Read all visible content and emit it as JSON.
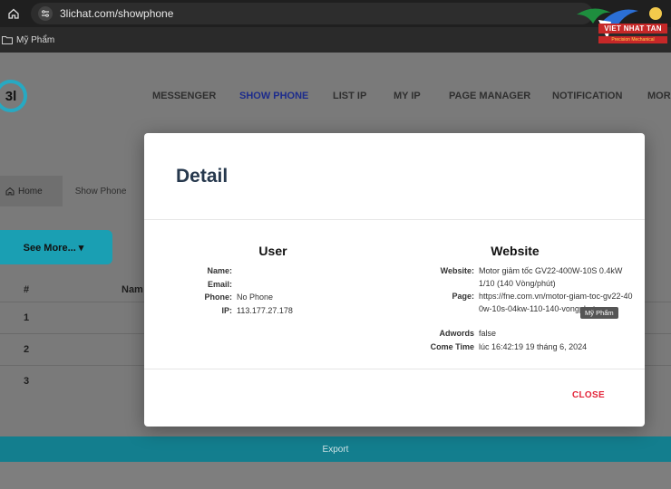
{
  "browser": {
    "url": "3lichat.com/showphone",
    "bookmark_label": "Mỹ Phẩm"
  },
  "logo": {
    "brand": "VIET NHAT TAN",
    "sub": "Precision Mechanical",
    "page_logo_text": "3l"
  },
  "nav": {
    "items": [
      "MESSENGER",
      "SHOW PHONE",
      "LIST IP",
      "MY IP",
      "PAGE MANAGER",
      "NOTIFICATION",
      "MOR"
    ],
    "active": "SHOW PHONE"
  },
  "breadcrumb": {
    "home": "Home",
    "current": "Show Phone"
  },
  "see_more_label": "See More... ▾",
  "table": {
    "headers": [
      "#",
      "Nam"
    ],
    "rows": [
      "1",
      "2",
      "3"
    ]
  },
  "export_label": "Export",
  "modal": {
    "title": "Detail",
    "user_heading": "User",
    "website_heading": "Website",
    "user": {
      "name_label": "Name:",
      "name_value": "",
      "email_label": "Email:",
      "email_value": "",
      "phone_label": "Phone:",
      "phone_value": "No Phone",
      "ip_label": "IP:",
      "ip_value": "113.177.27.178"
    },
    "website": {
      "website_label": "Website:",
      "website_value": "Motor giảm tốc GV22-400W-10S 0.4kW 1/10 (140 Vòng/phút)",
      "page_label": "Page:",
      "page_value": "https://fne.com.vn/motor-giam-toc-gv22-400w-10s-04kw-110-140-vongphut",
      "adwords_label": "Adwords",
      "adwords_value": "false",
      "cometime_label": "Come Time",
      "cometime_value": "lúc 16:42:19 19 tháng 6, 2024"
    },
    "tooltip": "Mỹ Phẩm",
    "close_label": "CLOSE"
  },
  "colors": {
    "accent": "#27a9c2",
    "close": "#e3253a",
    "title": "#26384d"
  }
}
